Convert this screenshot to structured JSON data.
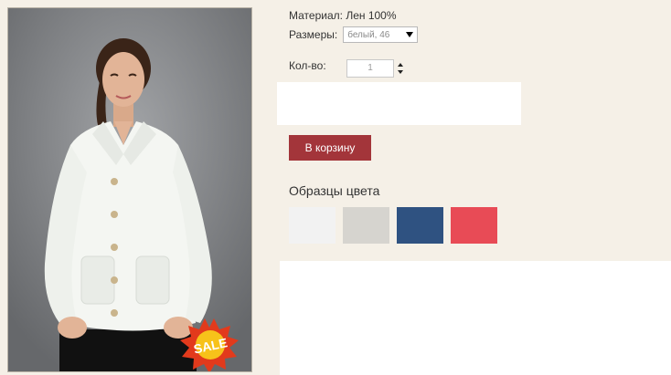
{
  "product": {
    "material_label": "Материал:",
    "material_value": "Лен 100%",
    "size_label": "Размеры:",
    "size_selected": "белый, 46",
    "qty_label": "Кол-во:",
    "qty_value": "1",
    "cart_button": "В корзину",
    "sale_badge": "SALE",
    "swatches_title": "Образцы цвета"
  },
  "swatches": [
    {
      "name": "white",
      "color": "#f2f2f2"
    },
    {
      "name": "light-gray",
      "color": "#d6d4cf"
    },
    {
      "name": "navy-blue",
      "color": "#2f5281"
    },
    {
      "name": "coral-red",
      "color": "#e84b56"
    }
  ],
  "colors": {
    "page_background": "#f5f0e7",
    "cart_button": "#a3353a",
    "photo_background": "#7d7f82"
  }
}
